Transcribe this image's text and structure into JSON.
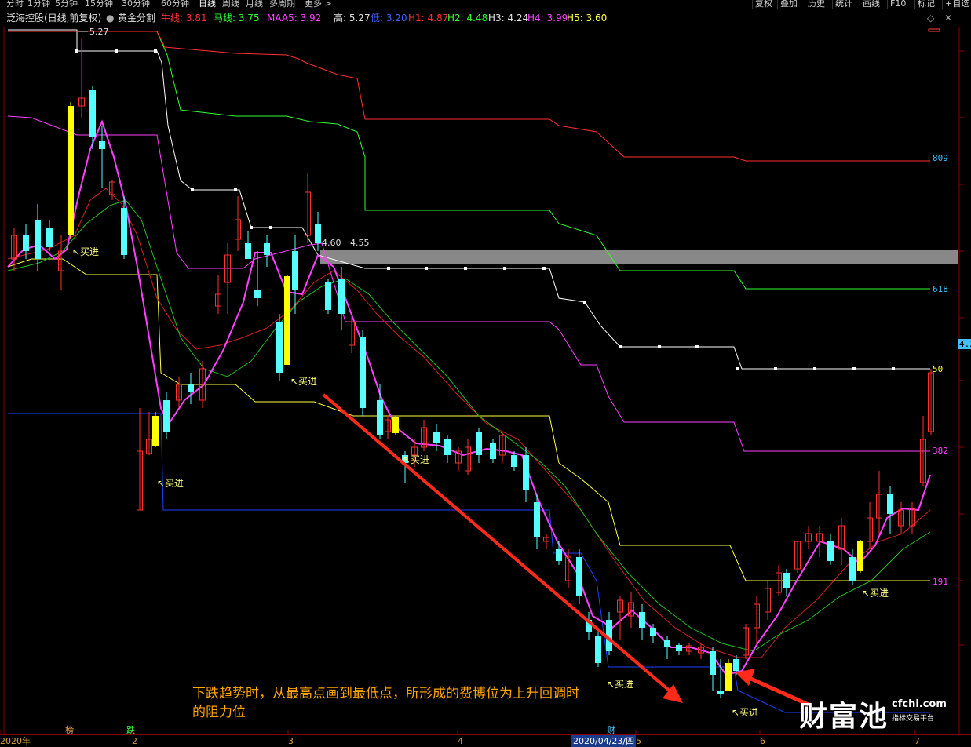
{
  "toolbar": {
    "tabs": [
      "分时",
      "1分钟",
      "5分钟",
      "15分钟",
      "30分钟",
      "60分钟",
      "日线",
      "周线",
      "月线",
      "多周期",
      "更多 >"
    ],
    "active_tab": "日线",
    "right_buttons": [
      "复权",
      "叠加",
      "历史",
      "统计",
      "画线",
      "F10",
      "标记",
      "+自选"
    ]
  },
  "info": {
    "stock": "泛海控股(日线,前复权)",
    "indicator": "黄金分割",
    "niuxian": "牛线: 3.81",
    "maxian": "马线: 3.75",
    "maa5": "MAA5: 3.92",
    "gao": "高: 5.27",
    "di": "低: 3.20",
    "h1": "H1: 4.87",
    "h2": "H2: 4.48",
    "h3": "H3: 4.24",
    "h4": "H4: 3.99",
    "h5": "H5: 3.60",
    "colors": {
      "niuxian": "#ff3030",
      "maxian": "#30ff30",
      "maa5": "#ff40ff",
      "gao": "#e0e0e0",
      "di": "#4060ff",
      "h1": "#ff3030",
      "h2": "#30ff30",
      "h3": "#e0e0e0",
      "h4": "#ff40ff",
      "h5": "#ffff40"
    }
  },
  "chart_labels": {
    "high_price": "5.27",
    "low_price": "3.20",
    "line_label_a": "4.60",
    "line_label_b": "4.55",
    "buy_signal": "买进"
  },
  "right_axis": {
    "fib": [
      "809",
      "618",
      "50",
      "382",
      "191"
    ],
    "current": "4.2"
  },
  "bottom": {
    "labels": [
      "2020年",
      "2",
      "3",
      "4",
      "2020/04/23/四",
      "5",
      "6",
      "7"
    ],
    "markers": [
      "榜",
      "跌",
      "财"
    ]
  },
  "annotation": {
    "line1": "下跌趋势时，从最高点画到最低点，所形成的费博位为上升回调时",
    "line2": "的阻力位"
  },
  "logo": {
    "name": "财富池",
    "url": "cfchi.com",
    "tagline": "指标交易平台"
  },
  "chart_data": {
    "type": "candlestick",
    "title": "泛海控股(日线,前复权)",
    "indicator": "黄金分割",
    "high": 5.27,
    "low": 3.2,
    "fib_levels": [
      {
        "name": "H1",
        "ratio": "809",
        "value": 4.87
      },
      {
        "name": "H2",
        "ratio": "618",
        "value": 4.48
      },
      {
        "name": "H3",
        "ratio": "50",
        "value": 4.24
      },
      {
        "name": "H4",
        "ratio": "382",
        "value": 3.99
      },
      {
        "name": "H5",
        "ratio": "191",
        "value": 3.6
      }
    ],
    "moving_averages": [
      {
        "name": "牛线",
        "last": 3.81
      },
      {
        "name": "马线",
        "last": 3.75
      },
      {
        "name": "MAA5",
        "last": 3.92
      }
    ]
  }
}
